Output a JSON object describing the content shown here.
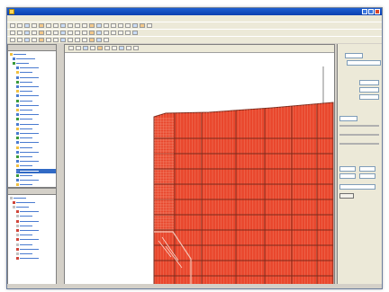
{
  "window": {
    "title": "",
    "accent": "#1d5fd1"
  },
  "menubar": {
    "items": [
      "",
      "",
      "",
      "",
      "",
      "",
      "",
      ""
    ]
  },
  "left_top_pane": {
    "header": "",
    "icons": [
      "folder-icon",
      "tree-node-icon",
      "selected-node-icon"
    ]
  },
  "left_bottom_pane": {
    "header": ""
  },
  "workspace": {
    "hull_color": "#e9472d",
    "hull_line_color": "#7a2a1c",
    "panel_labels": [
      "",
      "",
      "",
      "",
      "",
      "",
      "",
      ""
    ]
  },
  "right_panel": {
    "title": "",
    "button_label": "",
    "fields": [
      "",
      "",
      "",
      "",
      "",
      ""
    ]
  }
}
